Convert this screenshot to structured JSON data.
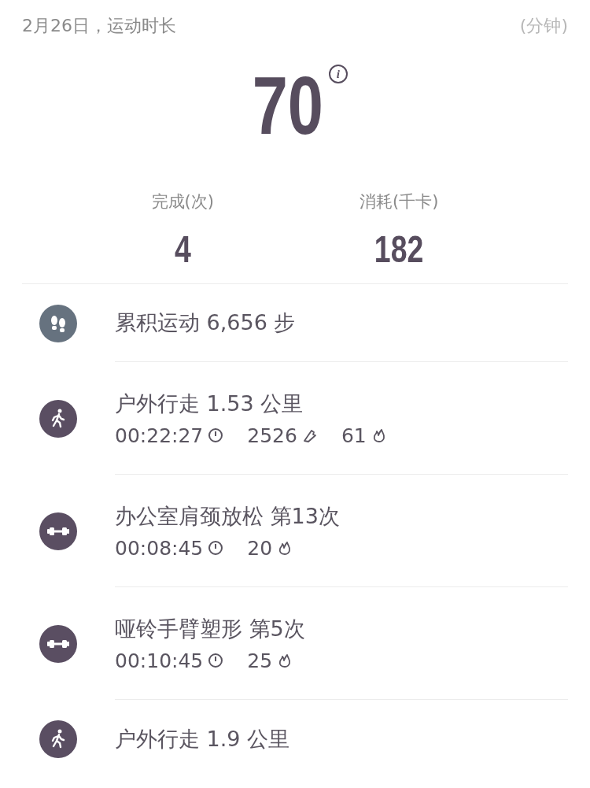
{
  "header": {
    "title": "2月26日，运动时长",
    "unit": "(分钟)"
  },
  "total": {
    "value": "70",
    "info_icon": "i"
  },
  "summary": [
    {
      "label": "完成(次)",
      "value": "4"
    },
    {
      "label": "消耗(千卡)",
      "value": "182"
    }
  ],
  "activities": [
    {
      "kind": "steps",
      "title": "累积运动 6,656 步"
    },
    {
      "kind": "walk",
      "title": "户外行走 1.53 公里",
      "stats": [
        {
          "kind": "time",
          "value": "00:22:27"
        },
        {
          "kind": "steps",
          "value": "2526"
        },
        {
          "kind": "calories",
          "value": "61"
        }
      ]
    },
    {
      "kind": "workout",
      "title": "办公室肩颈放松  第13次",
      "stats": [
        {
          "kind": "time",
          "value": "00:08:45"
        },
        {
          "kind": "calories",
          "value": "20"
        }
      ]
    },
    {
      "kind": "workout",
      "title": "哑铃手臂塑形  第5次",
      "stats": [
        {
          "kind": "time",
          "value": "00:10:45"
        },
        {
          "kind": "calories",
          "value": "25"
        }
      ]
    },
    {
      "kind": "walk",
      "title": "户外行走 1.9 公里"
    }
  ]
}
